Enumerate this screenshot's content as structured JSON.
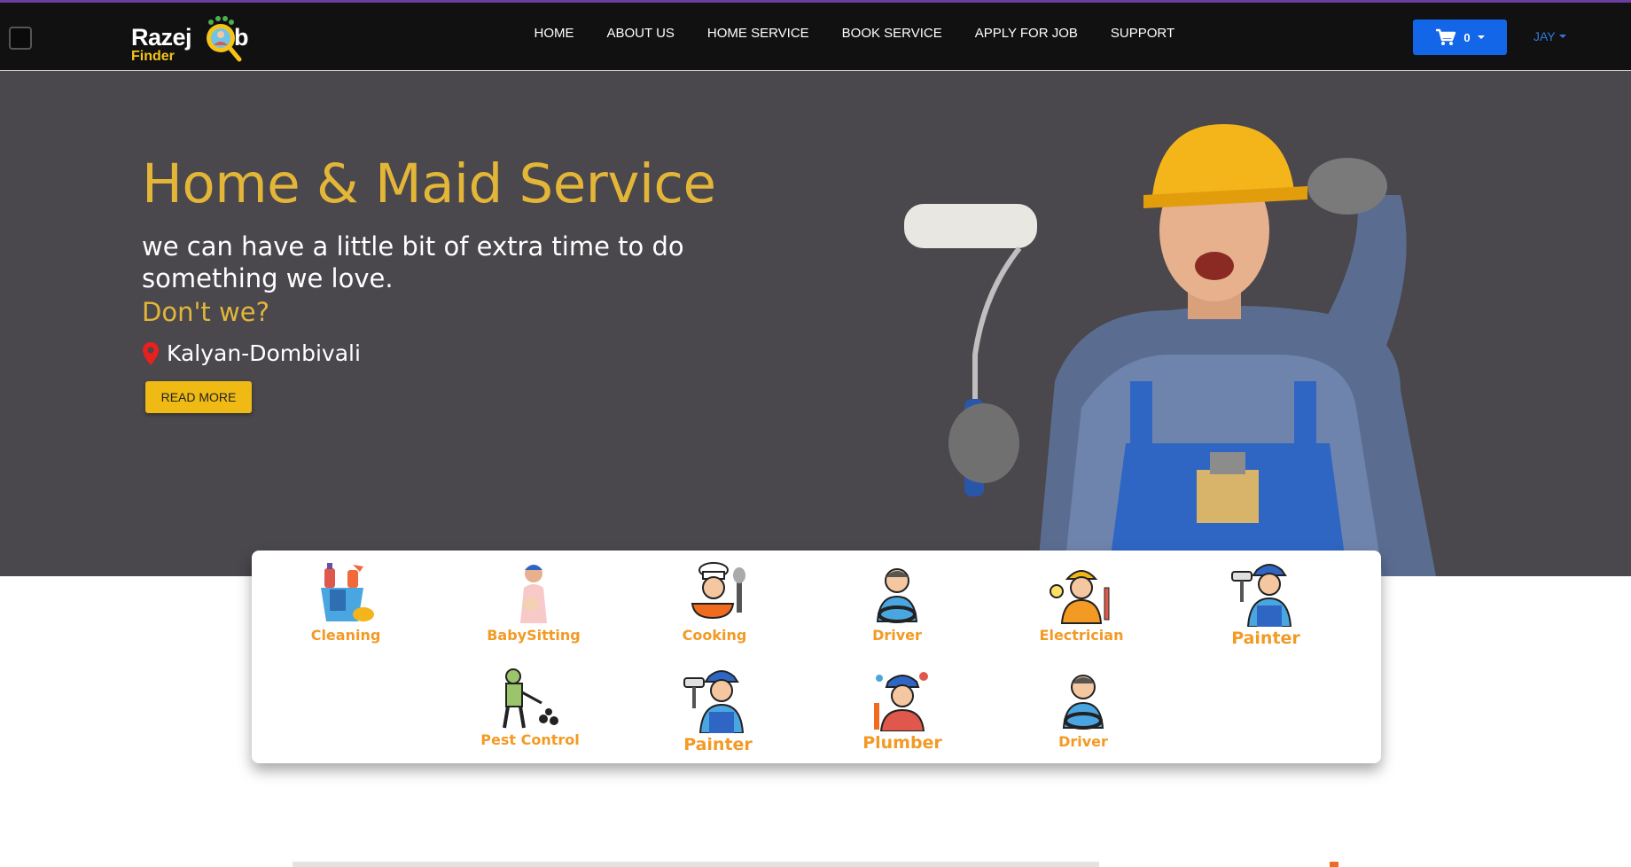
{
  "colors": {
    "accent_gold": "#e3b638",
    "button_yellow": "#efba14",
    "cart_blue": "#1366e8",
    "service_label_orange": "#f39a25",
    "hero_bg": "#4a474d",
    "navbar_bg": "#111111"
  },
  "brand": {
    "word1": "Razej",
    "word2": "b",
    "tagline": "Finder"
  },
  "nav": {
    "items": [
      "HOME",
      "ABOUT US",
      "HOME SERVICE",
      "BOOK SERVICE",
      "APPLY FOR JOB",
      "SUPPORT"
    ]
  },
  "cart": {
    "count": "0",
    "icon": "shopping-cart-icon"
  },
  "user": {
    "name": "JAY"
  },
  "hero": {
    "title": "Home & Maid Service",
    "subtitle": "we can have a little bit of extra time to do something we love.",
    "accent": "Don't we?",
    "location": "Kalyan-Dombivali",
    "cta": "READ MORE"
  },
  "services": [
    {
      "label": "Cleaning",
      "icon": "cleaning-icon"
    },
    {
      "label": "BabySitting",
      "icon": "babysitting-icon"
    },
    {
      "label": "Cooking",
      "icon": "cooking-icon"
    },
    {
      "label": "Driver",
      "icon": "driver-icon"
    },
    {
      "label": "Electrician",
      "icon": "electrician-icon"
    },
    {
      "label": "Painter",
      "icon": "painter-icon"
    },
    {
      "label": "Pest Control",
      "icon": "pest-control-icon"
    },
    {
      "label": "Painter",
      "icon": "painter-icon"
    },
    {
      "label": "Plumber",
      "icon": "plumber-icon"
    },
    {
      "label": "Driver",
      "icon": "driver-icon"
    }
  ]
}
